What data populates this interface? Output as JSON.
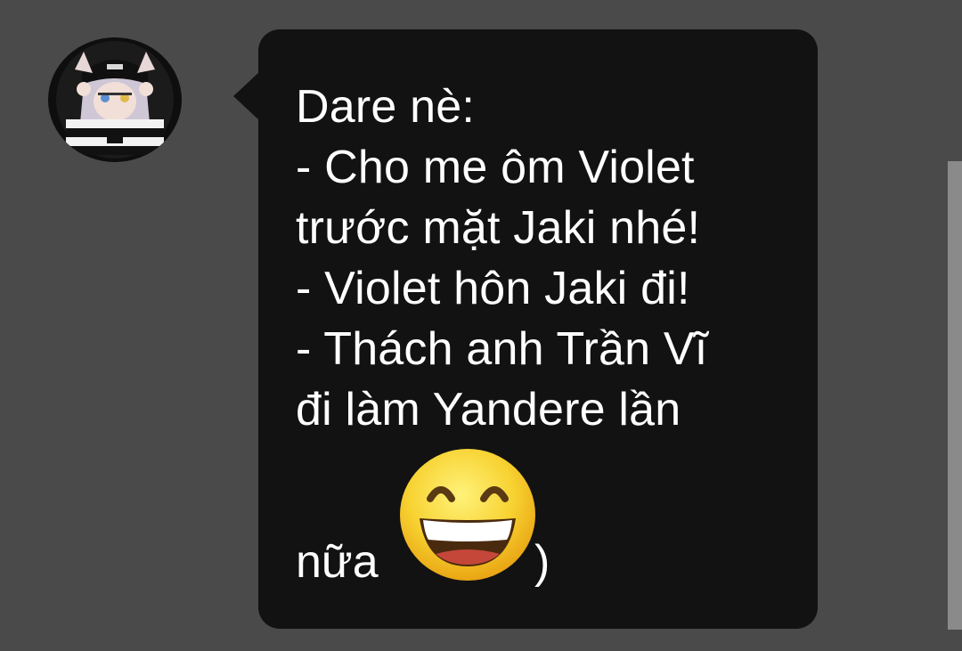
{
  "chat": {
    "sender": {
      "avatar_icon": "user-avatar"
    },
    "message": {
      "lines": [
        "Dare nè:",
        "- Cho me ôm Violet",
        "trước mặt Jaki nhé!",
        "- Violet hôn Jaki đi!",
        "- Thách anh Trần Vĩ",
        "đi làm Yandere lần"
      ],
      "last_word": "nữa",
      "emoji": "grinning-face-with-smiling-eyes",
      "closing": ")"
    }
  },
  "colors": {
    "background": "#4a4a4a",
    "bubble": "#121212",
    "text": "#ffffff",
    "scrollbar": "#8a8a8a"
  }
}
